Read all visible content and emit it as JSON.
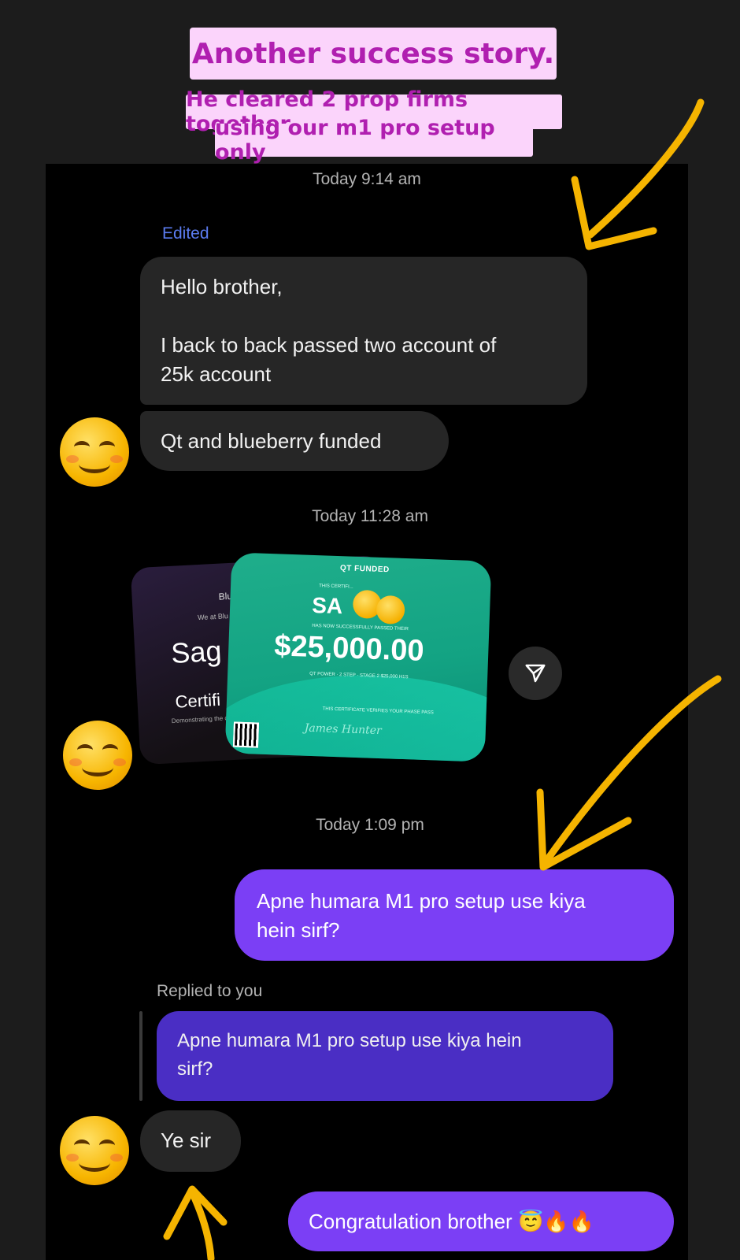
{
  "banner": {
    "title": "Another success story.",
    "subtitle_line1": "He cleared 2 prop firms together",
    "subtitle_line2": "using our m1 pro setup only"
  },
  "chat": {
    "timestamps": [
      "Today 9:14 am",
      "Today 11:28 am",
      "Today 1:09 pm"
    ],
    "edited_label": "Edited",
    "replied_label": "Replied to you",
    "messages": [
      {
        "from": "them",
        "text_line1": "Hello brother,",
        "text_line3": "I back to back passed two account of",
        "text_line4": "25k account"
      },
      {
        "from": "them",
        "text": "Qt and blueberry funded"
      },
      {
        "from": "me",
        "text_line1": "Apne humara M1 pro setup use kiya",
        "text_line2": "hein sirf?"
      },
      {
        "from": "quote",
        "text_line1": "Apne humara M1 pro setup use kiya hein",
        "text_line2": "sirf?"
      },
      {
        "from": "them",
        "text": "Ye sir"
      },
      {
        "from": "me",
        "text": "Congratulation brother 😇🔥🔥"
      }
    ],
    "certificate_back": {
      "t1": "Blu",
      "t2": "We at Blu",
      "name": "Sag",
      "label": "Certifi",
      "small": "Demonstrating the c"
    },
    "certificate_front": {
      "brand": "QT FUNDED",
      "small1": "THIS CERTIFI...",
      "name": "SA",
      "small2": "HAS NOW SUCCESSFULLY PASSED THEIR",
      "amount": "$25,000.00",
      "small3": "QT POWER · 2 STEP · STAGE 2 $25,000 H1S",
      "small4": "THIS CERTIFICATE VERIFIES YOUR PHASE PASS",
      "signature": "James Hunter"
    }
  },
  "colors": {
    "accent_out": "#7b3ff5",
    "quote": "#4a2ec4",
    "bubble_in": "#262626",
    "banner_bg": "#fbd4fb",
    "banner_text": "#b01fb0",
    "arrow": "#f5b400"
  }
}
